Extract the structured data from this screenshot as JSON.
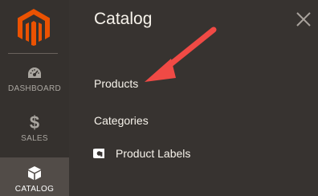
{
  "sidebar": {
    "logo_icon": "magento-logo-icon",
    "items": [
      {
        "label": "DASHBOARD",
        "icon": "speedometer-icon"
      },
      {
        "label": "SALES",
        "icon": "dollar-icon",
        "glyph": "$"
      },
      {
        "label": "CATALOG",
        "icon": "cube-icon",
        "active": true
      }
    ]
  },
  "panel": {
    "title": "Catalog",
    "close_icon": "close-icon",
    "items": [
      {
        "label": "Products"
      },
      {
        "label": "Categories"
      },
      {
        "label": "Product Labels",
        "icon": "amasty-icon"
      }
    ]
  },
  "annotation": {
    "icon": "red-arrow-icon",
    "color": "#f04a45"
  },
  "colors": {
    "sidebar_bg": "#35312e",
    "panel_bg": "#373330",
    "logo": "#eb5202",
    "active_item_bg": "#524c48"
  }
}
